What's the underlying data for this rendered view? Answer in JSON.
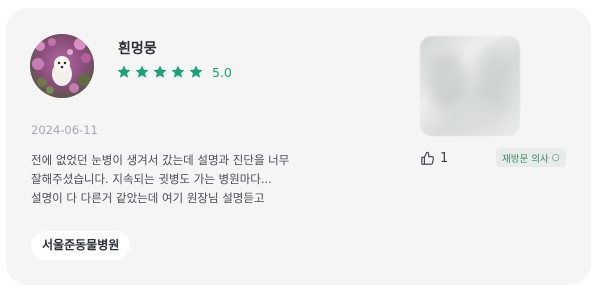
{
  "review": {
    "username": "흰멍뭉",
    "rating": 5.0,
    "rating_label": "5.0",
    "stars": 5,
    "date": "2024-06-11",
    "text": "전에 없었던 눈병이 생겨서 갔는데 설명과 진단을 너무\n잘해주셨습니다. 지속되는 귓병도 가는 병원마다...\n설명이 다 다른거 같았는데 여기 원장님 설명듣고",
    "hospital": "서울준동물병원",
    "likes": "1",
    "visit_badge": "재방문 의사",
    "visit_badge_icon": "circle-check-icon"
  },
  "colors": {
    "card_bg": "#f5f5f5",
    "star": "#1aa37a",
    "rating_text": "#1aa37a",
    "badge_bg": "#e7ece9",
    "badge_text": "#3f8a6b"
  }
}
